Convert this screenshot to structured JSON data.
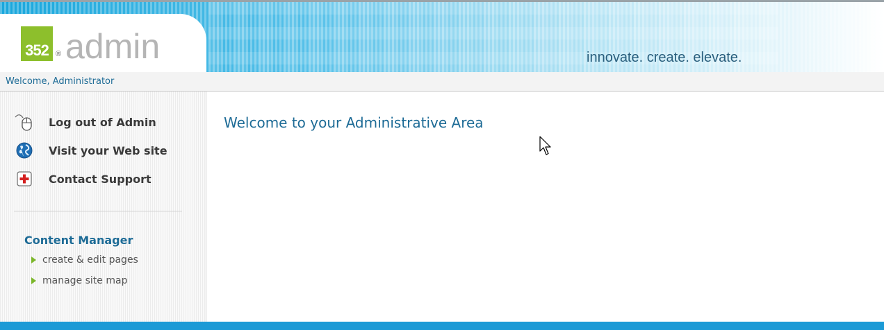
{
  "header": {
    "logo_number": "352",
    "logo_registered": "®",
    "logo_word": "admin",
    "tagline": "innovate. create. elevate."
  },
  "welcome_bar": {
    "text": "Welcome, Administrator"
  },
  "sidebar": {
    "links": [
      {
        "label": "Log out of Admin",
        "icon": "mouse-icon"
      },
      {
        "label": "Visit your Web site",
        "icon": "globe-icon"
      },
      {
        "label": "Contact Support",
        "icon": "first-aid-icon"
      }
    ],
    "content_manager": {
      "heading": "Content Manager",
      "items": [
        {
          "label": "create & edit pages"
        },
        {
          "label": "manage site map"
        }
      ]
    }
  },
  "main": {
    "title": "Welcome to your Administrative Area"
  },
  "colors": {
    "accent": "#1d6b96",
    "brand_green": "#8dbf2c",
    "bottom_bar": "#1b9ad6"
  }
}
